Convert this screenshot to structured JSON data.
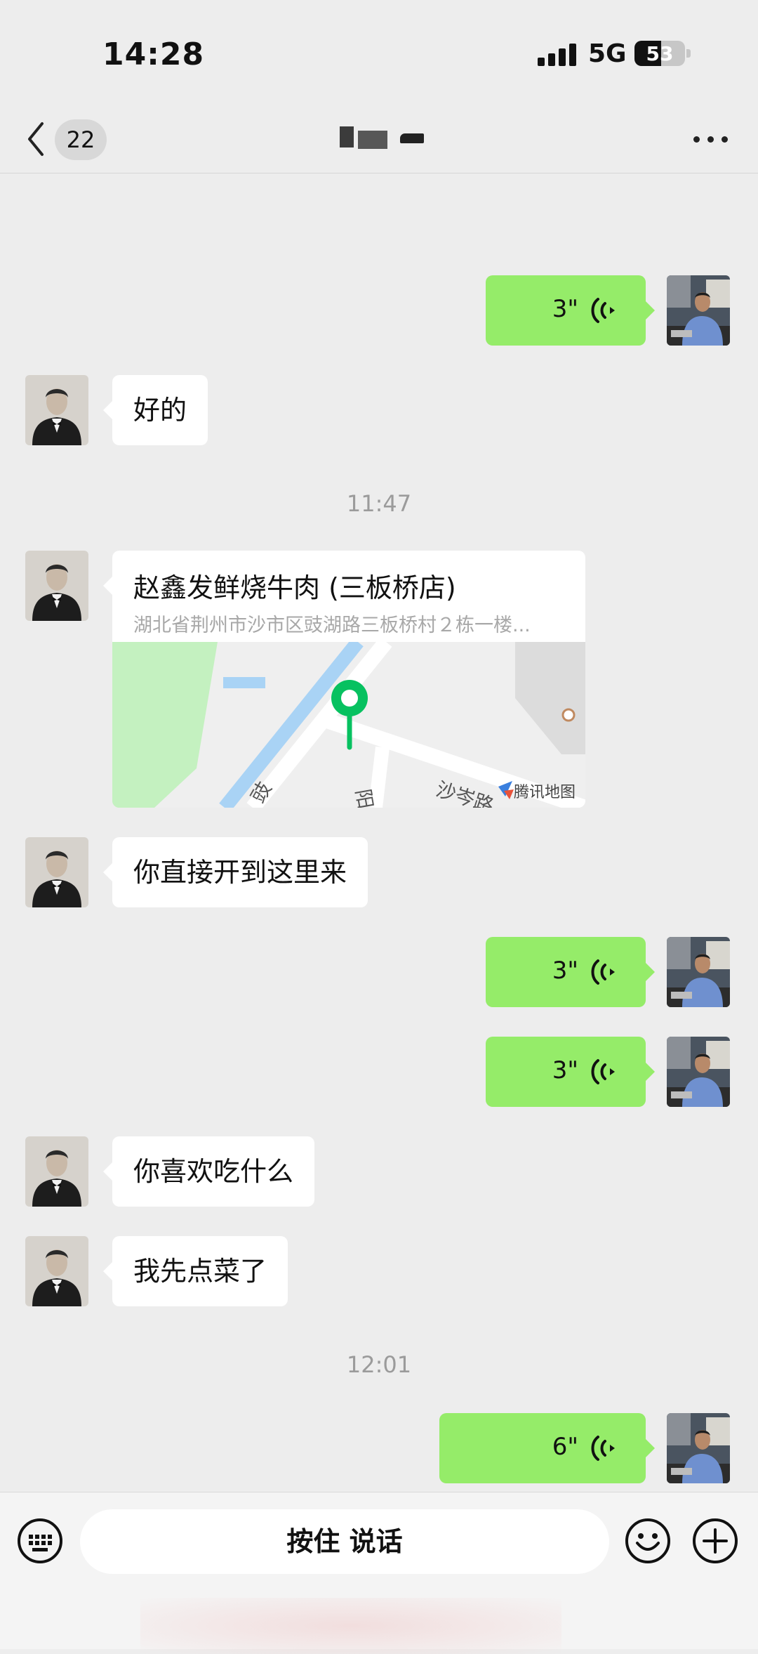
{
  "status_bar": {
    "time": "14:28",
    "network": "5G",
    "battery": "53",
    "battery_level": 0.53
  },
  "nav": {
    "unread_count": "22"
  },
  "messages": {
    "m1_voice_duration": "3\"",
    "m2_text": "好的",
    "time_1": "11:47",
    "location": {
      "name": "赵鑫发鲜烧牛肉 (三板桥店)",
      "address": "湖北省荆州市沙市区豉湖路三板桥村２栋一楼...",
      "map_labels": {
        "road_a": "豉",
        "road_b": "阳",
        "road_c": "沙岑路"
      },
      "map_brand": "腾讯地图"
    },
    "m4_text": "你直接开到这里来",
    "m5_voice_duration": "3\"",
    "m6_voice_duration": "3\"",
    "m7_text": "你喜欢吃什么",
    "m8_text": "我先点菜了",
    "time_2": "12:01",
    "m9_voice_duration": "6\""
  },
  "input_bar": {
    "hold_to_talk": "按住 说话"
  },
  "colors": {
    "self_bubble": "#95ec69",
    "other_bubble": "#ffffff",
    "background": "#ededed",
    "map_pin": "#07c160"
  },
  "icons": {
    "back": "chevron-left-icon",
    "more": "more-dots-icon",
    "voice": "voice-wave-icon",
    "keyboard": "keyboard-icon",
    "emoji": "emoji-icon",
    "plus": "plus-icon"
  }
}
